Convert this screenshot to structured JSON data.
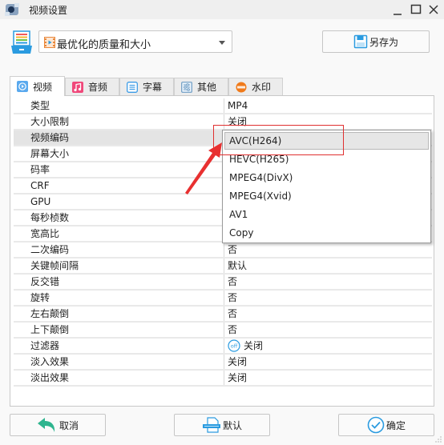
{
  "window": {
    "title": "视频设置",
    "controls": {
      "minimize": "minimize",
      "maximize": "maximize",
      "close": "close"
    }
  },
  "preset": {
    "selected": "最优化的质量和大小",
    "icon": "film-icon"
  },
  "toolbar": {
    "save_as_label": "另存为"
  },
  "tabs": [
    {
      "label": "视频",
      "icon": "video-icon",
      "active": true
    },
    {
      "label": "音频",
      "icon": "music-icon",
      "active": false
    },
    {
      "label": "字幕",
      "icon": "subtitle-icon",
      "active": false
    },
    {
      "label": "其他",
      "icon": "settings-sliders-icon",
      "active": false
    },
    {
      "label": "水印",
      "icon": "watermark-new-icon",
      "active": false
    }
  ],
  "properties": [
    {
      "key": "类型",
      "value": "MP4"
    },
    {
      "key": "大小限制",
      "value": "关闭"
    },
    {
      "key": "视频编码",
      "value": "AVC(H264)",
      "selected": true
    },
    {
      "key": "屏幕大小",
      "value": ""
    },
    {
      "key": "码率",
      "value": ""
    },
    {
      "key": "CRF",
      "value": ""
    },
    {
      "key": "GPU",
      "value": ""
    },
    {
      "key": "每秒桢数",
      "value": ""
    },
    {
      "key": "宽高比",
      "value": ""
    },
    {
      "key": "二次编码",
      "value": "否"
    },
    {
      "key": "关键帧间隔",
      "value": "默认"
    },
    {
      "key": "反交错",
      "value": "否"
    },
    {
      "key": "旋转",
      "value": "否"
    },
    {
      "key": "左右颠倒",
      "value": "否"
    },
    {
      "key": "上下颠倒",
      "value": "否"
    },
    {
      "key": "过滤器",
      "value": "关闭",
      "icon": "off-icon"
    },
    {
      "key": "淡入效果",
      "value": "关闭"
    },
    {
      "key": "淡出效果",
      "value": "关闭"
    }
  ],
  "codec_dropdown": {
    "options": [
      "AVC(H264)",
      "HEVC(H265)",
      "MPEG4(DivX)",
      "MPEG4(Xvid)",
      "AV1",
      "Copy"
    ],
    "highlighted": "AVC(H264)"
  },
  "footer": {
    "cancel_label": "取消",
    "default_label": "默认",
    "ok_label": "确定"
  },
  "colors": {
    "annotation": "#e03030",
    "accent_blue": "#2a9be0",
    "cancel_green": "#2fb58f"
  }
}
